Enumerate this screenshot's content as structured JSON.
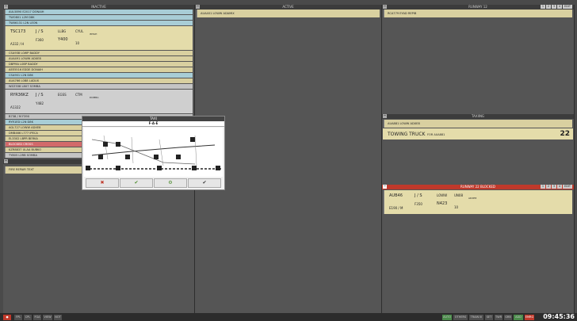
{
  "columns": {
    "inactive": "INACTIVE",
    "active": "ACTIVE",
    "runway12": "RUNWAY 12",
    "taxiing": "TAXIING",
    "runway22": "RUNWAY 22   BLOCKED"
  },
  "runway_tabs": [
    "1",
    "2",
    "3",
    "4",
    "EDIT"
  ],
  "inactive_strips_top": [
    {
      "text": "AUL5890  E2017  DONAIH",
      "color": "s-blu"
    },
    {
      "text": "TWO801  L2M    D8K",
      "color": "s-blu"
    },
    {
      "text": "TW06131  L2N   LEON",
      "color": "s-blu"
    }
  ],
  "big1": {
    "callsign": "TSC173",
    "wt": "J / S",
    "stand": "LLBG",
    "dest": "CYUL",
    "aircraft": "A332 / H",
    "squawk": "F360",
    "rwy": "Y400",
    "num": "10",
    "sid": "IMTAH"
  },
  "inactive_strips_mid": [
    {
      "text": "CSA938  L0WP   BADDY",
      "color": "s-yel"
    },
    {
      "text": "AUA491  LOWW   ADXE8",
      "color": "s-yel"
    },
    {
      "text": "DBPMA   L0BP   BADDY",
      "color": "s-yel"
    },
    {
      "text": "AEE5516  EDDE   DONAIH",
      "color": "s-yel"
    },
    {
      "text": "CSA901  L2N    D8K",
      "color": "s-blu"
    },
    {
      "text": "AUA766  L0B8   LADUX",
      "color": "s-yel"
    },
    {
      "text": "WZZ338  L8X7   SOMBA",
      "color": "s-gry"
    }
  ],
  "big2": {
    "callsign": "RYR36KZ",
    "wt": "J / S",
    "stand": "EGSS",
    "dest": "CTM",
    "aircraft": "A1322",
    "squawk": "Y482",
    "rwy": "",
    "num": "",
    "sid": "DOMBA"
  },
  "big2_line": "B738 / M   F390",
  "inactive_strips_bottom": [
    {
      "text": "RYR1ED  L2N    D8K",
      "color": "s-blu"
    },
    {
      "text": "AGL727  LOWW  ADXE8",
      "color": "s-yel"
    },
    {
      "text": "DMB466  L777   IPECA",
      "color": "s-yel"
    },
    {
      "text": "EL3302  LBPR   BERKA",
      "color": "s-yel"
    },
    {
      "text": "BLOCKED CROSS",
      "color": "s-red"
    },
    {
      "text": "KZR8837  ULAA   BUBKO",
      "color": "s-yel"
    },
    {
      "text": "TY805  L2RB   SOMBA",
      "color": "s-gry"
    }
  ],
  "inactive_bottom_text": "FIRE  REPAIR TEXT",
  "active_strip": "AUA401  LOWW  ADAMIX",
  "runway12_strip": "RCA779  EYAD   REPIB",
  "taxiing_strip": "AUA881  LOWW  ADXE8",
  "towing": {
    "label": "TOWING TRUCK",
    "sub": "FOR AUA881",
    "num": "22"
  },
  "rw22_big": {
    "callsign": "AUB46",
    "wt": "J / S",
    "stand": "LOWW",
    "dest": "UN08",
    "aircraft": "E190 / M",
    "squawk": "F350",
    "rwy": "N423",
    "num": "10",
    "sid": "ADXE8"
  },
  "dialog": {
    "header": "TAXI",
    "title": "F-A-E",
    "buttons": [
      "✖",
      "✔",
      "⚙",
      "✔"
    ]
  },
  "bottom_buttons": [
    "FPL",
    "CPL",
    "FGA",
    "VIEW",
    "NOT"
  ],
  "bottom_right_buttons": [
    "AUTO",
    "OTHERS",
    "TRAIN III",
    "SET",
    "TWR",
    "GRB",
    "ADD",
    "EMRG"
  ],
  "clock": "09:45:36"
}
